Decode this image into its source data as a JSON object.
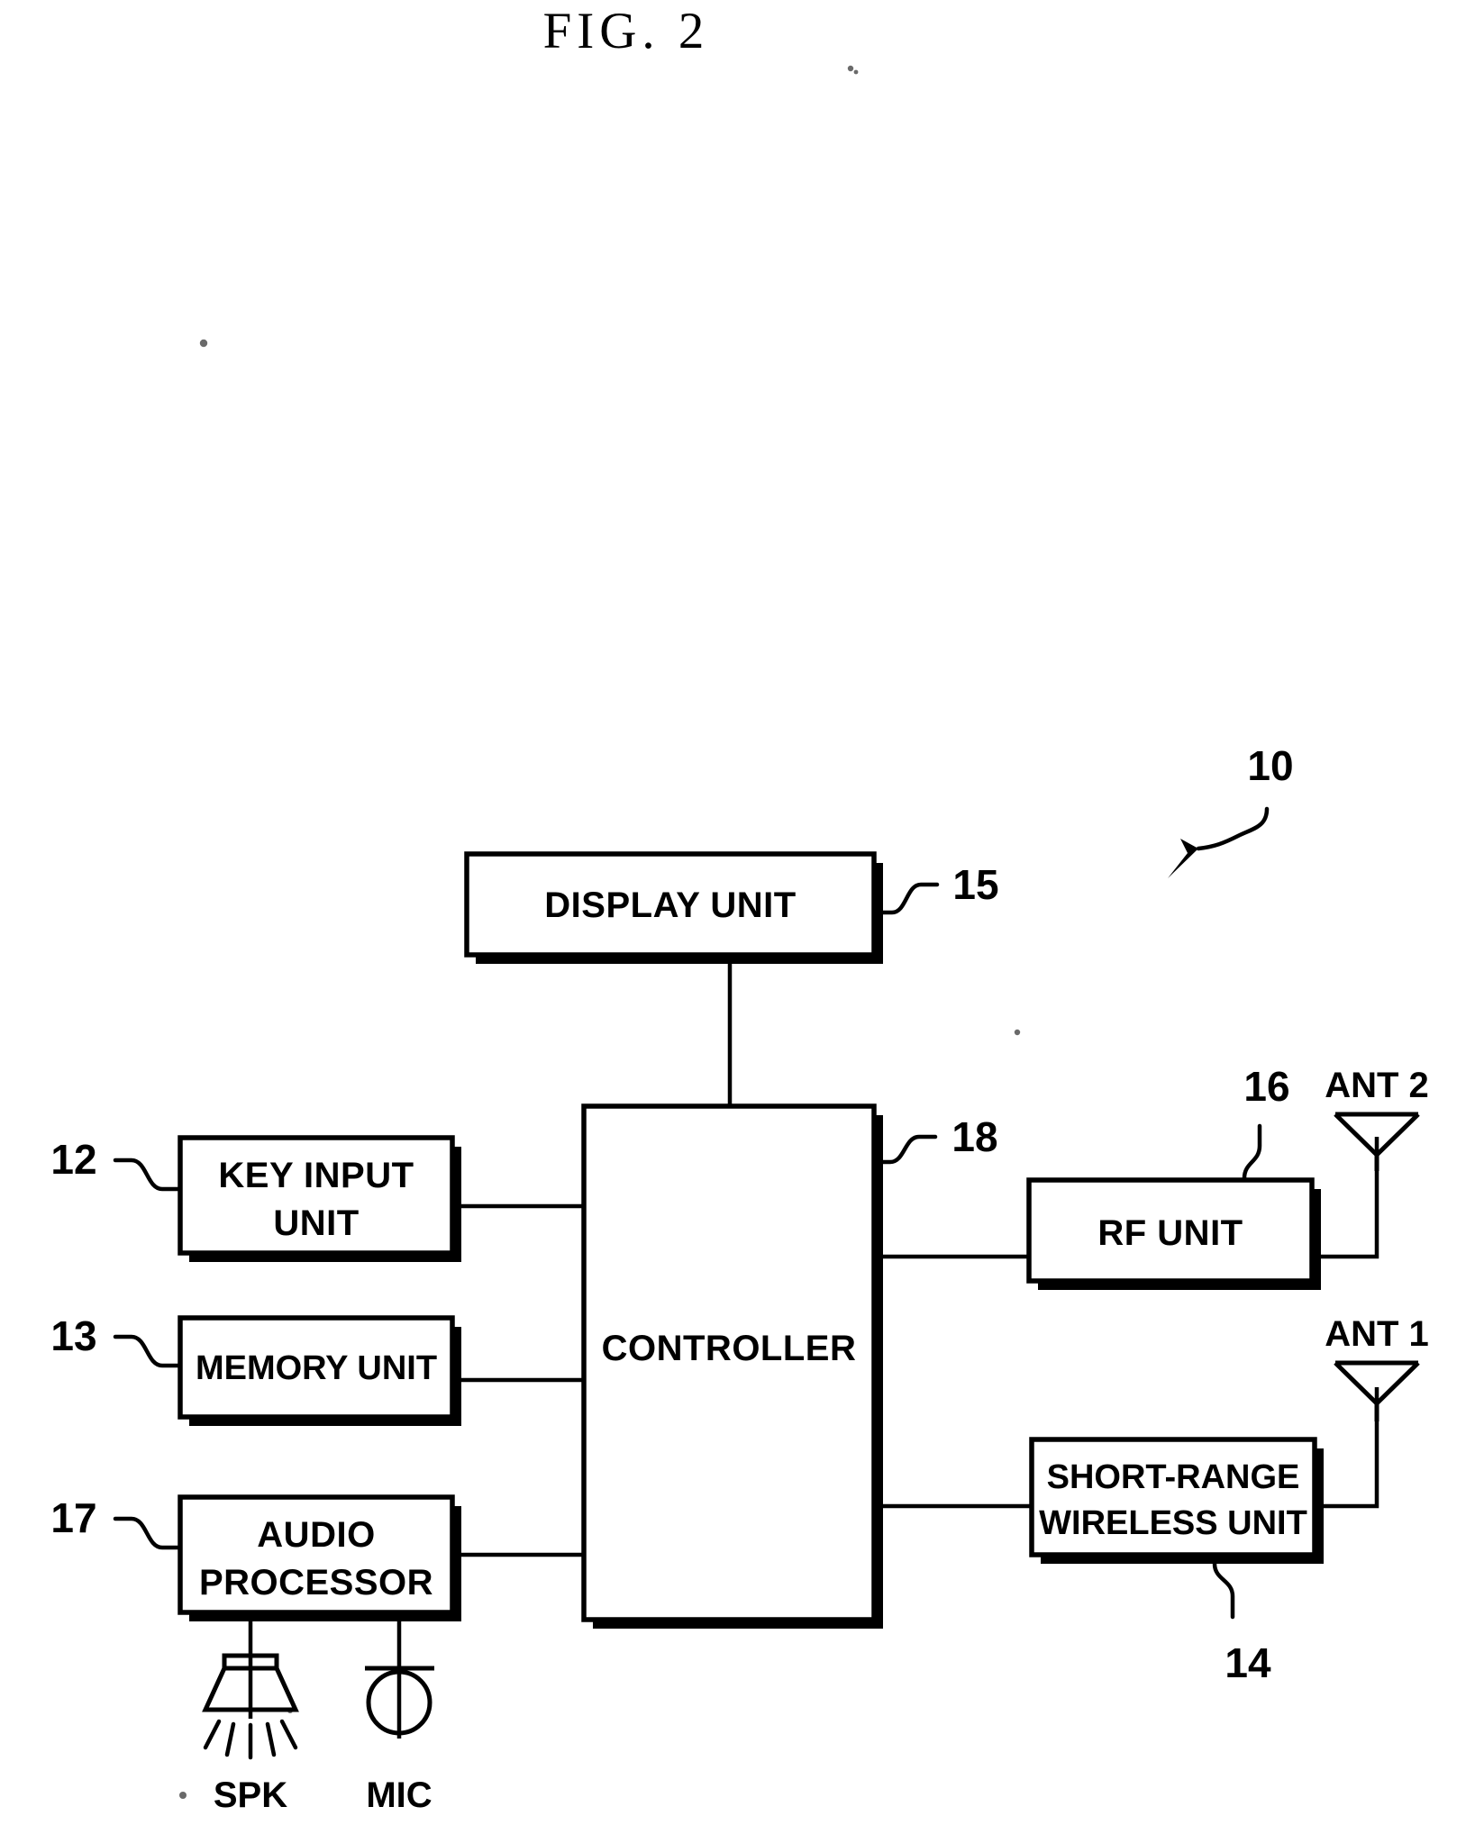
{
  "figure": {
    "title": "FIG. 2",
    "overall_ref": "10"
  },
  "blocks": [
    {
      "id": "display_unit",
      "label": "DISPLAY UNIT",
      "ref": "15"
    },
    {
      "id": "key_input_unit",
      "label_line1": "KEY INPUT",
      "label_line2": "UNIT",
      "ref": "12"
    },
    {
      "id": "memory_unit",
      "label": "MEMORY UNIT",
      "ref": "13"
    },
    {
      "id": "audio_processor",
      "label_line1": "AUDIO",
      "label_line2": "PROCESSOR",
      "ref": "17"
    },
    {
      "id": "controller",
      "label": "CONTROLLER",
      "ref": "18"
    },
    {
      "id": "rf_unit",
      "label": "RF UNIT",
      "ref": "16"
    },
    {
      "id": "short_range_wireless_unit",
      "label_line1": "SHORT-RANGE",
      "label_line2": "WIRELESS UNIT",
      "ref": "14"
    }
  ],
  "block_labels": {
    "display_unit": "DISPLAY UNIT",
    "key_input_unit_l1": "KEY INPUT",
    "key_input_unit_l2": "UNIT",
    "memory_unit": "MEMORY UNIT",
    "audio_processor_l1": "AUDIO",
    "audio_processor_l2": "PROCESSOR",
    "controller": "CONTROLLER",
    "rf_unit": "RF UNIT",
    "short_range_l1": "SHORT-RANGE",
    "short_range_l2": "WIRELESS UNIT"
  },
  "refs": {
    "display_unit": "15",
    "key_input_unit": "12",
    "memory_unit": "13",
    "audio_processor": "17",
    "controller": "18",
    "rf_unit": "16",
    "short_range_wireless_unit": "14",
    "overall": "10"
  },
  "peripherals": {
    "antenna_2": "ANT 2",
    "antenna_1": "ANT 1",
    "speaker": "SPK",
    "microphone": "MIC"
  },
  "colors": {
    "ink": "#000000",
    "paper": "#ffffff"
  }
}
